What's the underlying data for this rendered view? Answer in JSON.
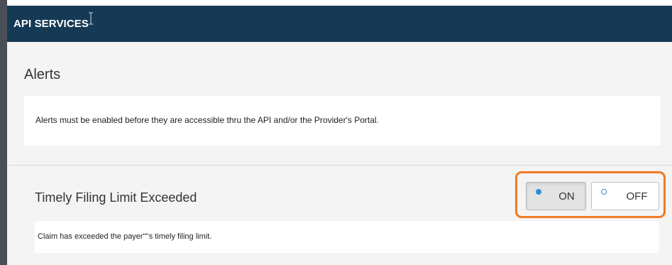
{
  "header": {
    "title": "API SERVICES"
  },
  "alerts_section": {
    "title": "Alerts",
    "info": "Alerts must be enabled before they are accessible thru the API and/or the Provider's Portal."
  },
  "alert_item": {
    "title": "Timely Filing Limit Exceeded",
    "description": "Claim has exceeded the payer'\"'s timely filing limit.",
    "toggle": {
      "on_label": "ON",
      "off_label": "OFF",
      "selected": "ON"
    }
  },
  "colors": {
    "header_bg": "#163a55",
    "highlight": "#f07a24",
    "radio": "#2a8fd6"
  }
}
